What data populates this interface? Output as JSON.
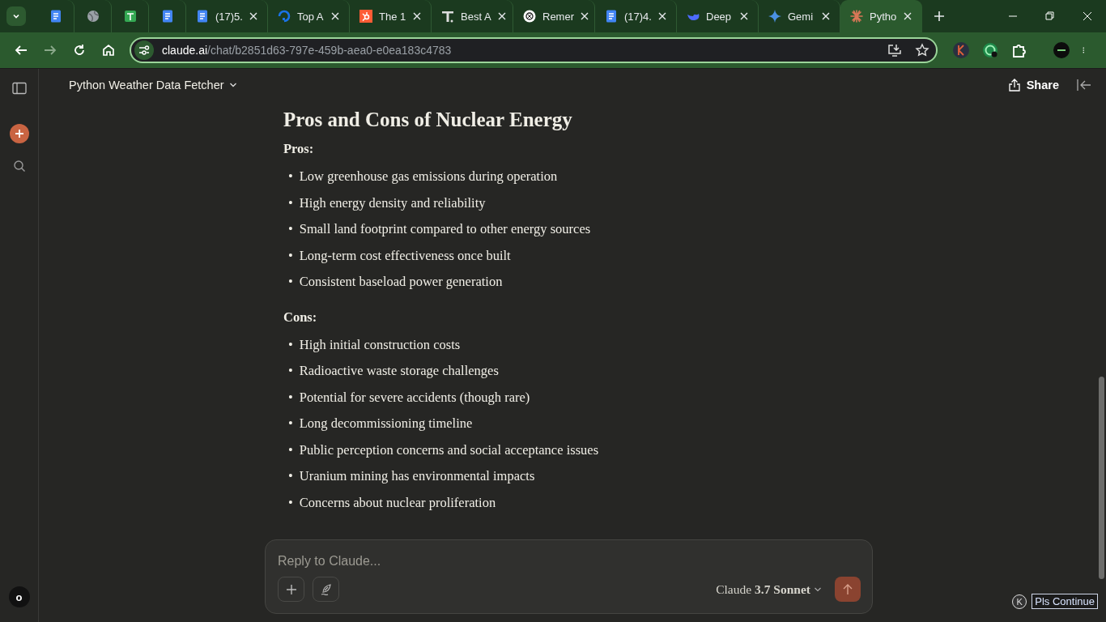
{
  "tabs": [
    {
      "kind": "docs",
      "selected": false
    },
    {
      "kind": "globe",
      "selected": false
    },
    {
      "kind": "sheets",
      "selected": false
    },
    {
      "kind": "docs",
      "selected": false
    },
    {
      "kind": "docs",
      "title": "(17)5.",
      "selected": false
    },
    {
      "kind": "ring",
      "title": "Top A",
      "selected": false
    },
    {
      "kind": "hub",
      "title": "The 1",
      "selected": false
    },
    {
      "kind": "tee",
      "title": "Best A",
      "selected": false
    },
    {
      "kind": "knot",
      "title": "Remer",
      "selected": false
    },
    {
      "kind": "docs",
      "title": "(17)4.",
      "selected": false
    },
    {
      "kind": "whale",
      "title": "Deep",
      "selected": false
    },
    {
      "kind": "spark",
      "title": "Gemi",
      "selected": false
    },
    {
      "kind": "burst",
      "title": "Pytho",
      "selected": true
    }
  ],
  "address": {
    "host": "claude.ai",
    "path": "/chat/b2851d63-797e-459b-aea0-e0ea183c4783"
  },
  "conversation_title": "Python Weather Data Fetcher",
  "share_label": "Share",
  "user_initial": "o",
  "heading": "Pros and Cons of Nuclear Energy",
  "bullet": "•",
  "sections": [
    {
      "label": "Pros:",
      "items": [
        "Low greenhouse gas emissions during operation",
        "High energy density and reliability",
        "Small land footprint compared to other energy sources",
        "Long-term cost effectiveness once built",
        "Consistent baseload power generation"
      ]
    },
    {
      "label": "Cons:",
      "items": [
        "High initial construction costs",
        "Radioactive waste storage challenges",
        "Potential for severe accidents (though rare)",
        "Long decommissioning timeline",
        "Public perception concerns and social acceptance issues",
        "Uranium mining has environmental impacts",
        "Concerns about nuclear proliferation"
      ]
    }
  ],
  "composer": {
    "placeholder": "Reply to Claude...",
    "model": "Claude **3.7 Sonnet**"
  },
  "extension_badge": {
    "letter": "K",
    "label": "Pls Continue"
  }
}
